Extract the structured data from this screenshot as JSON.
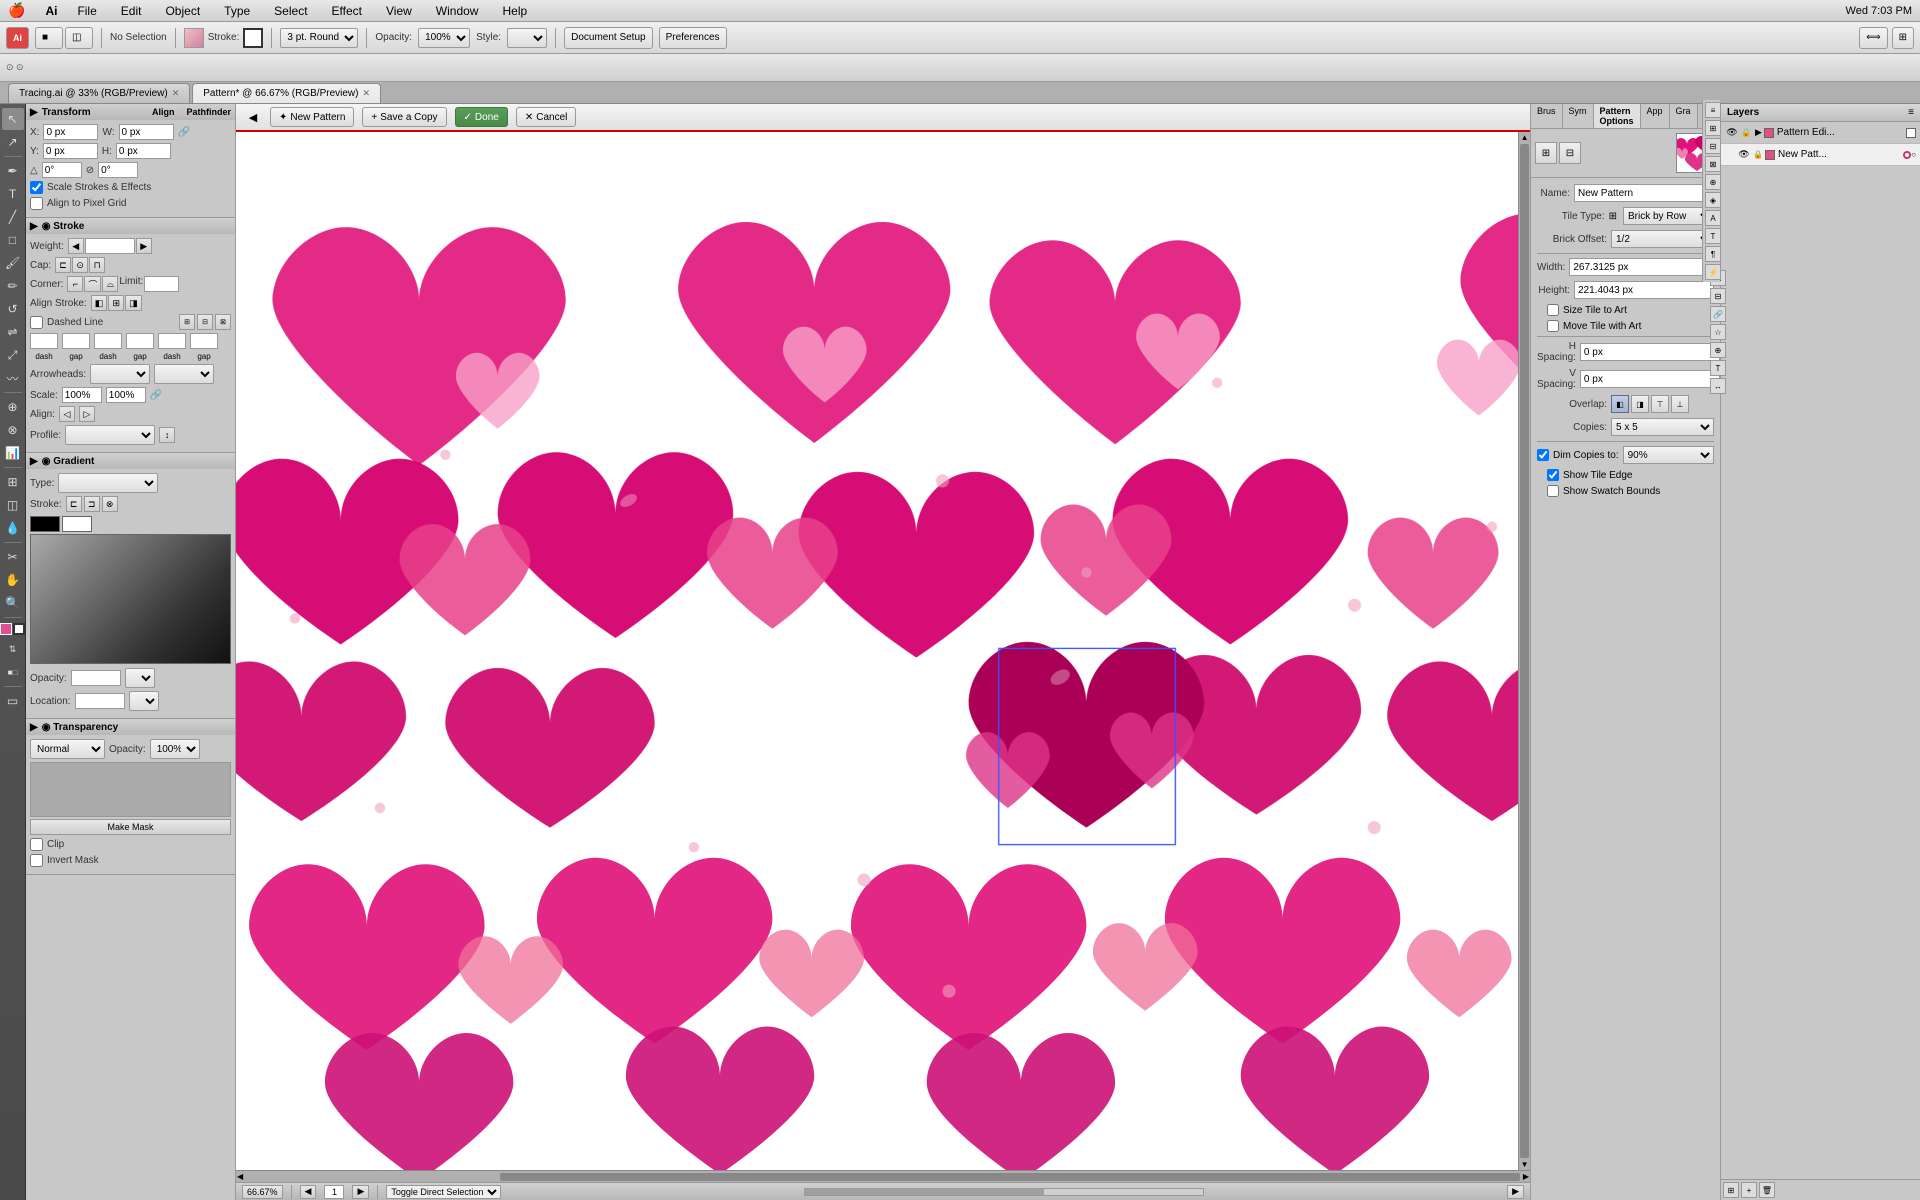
{
  "menubar": {
    "apple": "🍎",
    "app": "Illustrator",
    "items": [
      "File",
      "Edit",
      "Object",
      "Type",
      "Select",
      "Effect",
      "View",
      "Window",
      "Help"
    ],
    "right": "Wed 7:03 PM"
  },
  "toolbar": {
    "selection_label": "No Selection",
    "stroke_label": "Stroke:",
    "stroke_value": "",
    "weight_label": "3 pt. Round",
    "opacity_label": "Opacity:",
    "opacity_value": "100%",
    "style_label": "Style:",
    "btn_document_setup": "Document Setup",
    "btn_preferences": "Preferences"
  },
  "tabs": [
    {
      "id": "tab1",
      "label": "Tracing.ai @ 33% (RGB/Preview)",
      "active": false
    },
    {
      "id": "tab2",
      "label": "Pattern* @ 66.67% (RGB/Preview)",
      "active": true
    }
  ],
  "pattern_bar": {
    "new_pattern": "New Pattern",
    "save_copy": "Save a Copy",
    "done": "Done",
    "cancel": "Cancel"
  },
  "left_panel": {
    "transform": {
      "title": "Transform",
      "x_label": "X:",
      "x_value": "0 px",
      "y_label": "Y:",
      "y_value": "0 px",
      "w_label": "W:",
      "w_value": "0 px",
      "h_label": "H:",
      "h_value": "0 px",
      "scale_strokes": "Scale Strokes & Effects",
      "align_pixel": "Align to Pixel Grid"
    },
    "stroke": {
      "title": "Stroke",
      "weight_label": "Weight:",
      "cap_label": "Cap:",
      "corner_label": "Corner:",
      "limit_label": "Limit:",
      "align_label": "Align Stroke:",
      "dashed_label": "Dashed Line",
      "dash_label": "dash",
      "gap_label": "gap",
      "arrowheads_label": "Arrowheads:",
      "scale_label": "Scale:",
      "scale_val1": "100%",
      "scale_val2": "100%",
      "align_label2": "Align:"
    },
    "gradient": {
      "title": "Gradient",
      "type_label": "Type:",
      "stroke_label": "Stroke:",
      "opacity_label": "Opacity:",
      "location_label": "Location:"
    },
    "transparency": {
      "title": "Transparency",
      "mode": "Normal",
      "opacity": "100%",
      "make_mask": "Make Mask",
      "clip": "Clip",
      "invert_mask": "Invert Mask"
    }
  },
  "pattern_options": {
    "tabs": [
      "Brus",
      "Sym",
      "Pattern Options",
      "App",
      "Gra"
    ],
    "active_tab": "Pattern Options",
    "name_label": "Name:",
    "name_value": "New Pattern",
    "tile_type_label": "Tile Type:",
    "tile_type_value": "Brick by Row",
    "brick_offset_label": "Brick Offset:",
    "brick_offset_value": "1/2",
    "width_label": "Width:",
    "width_value": "267.3125 px",
    "height_label": "Height:",
    "height_value": "221.4043 px",
    "size_tile_art": "Size Tile to Art",
    "move_tile_art": "Move Tile with Art",
    "h_spacing_label": "H Spacing:",
    "h_spacing_value": "0 px",
    "v_spacing_label": "V Spacing:",
    "v_spacing_value": "0 px",
    "overlap_label": "Overlap:",
    "copies_label": "Copies:",
    "copies_value": "5 x 5",
    "dim_copies": "Dim Copies to:",
    "dim_value": "90%",
    "show_tile_edge": "Show Tile Edge",
    "show_swatch_bounds": "Show Swatch Bounds"
  },
  "layers": {
    "title": "Layers",
    "items": [
      {
        "label": "Pattern Edi...",
        "color": "#e05080",
        "visible": true,
        "locked": false,
        "expanded": true
      },
      {
        "label": "New Patt...",
        "color": "#e05080",
        "visible": true,
        "locked": false,
        "expanded": false,
        "indent": true
      }
    ]
  },
  "statusbar": {
    "zoom": "66.67%",
    "page": "1",
    "tool": "Toggle Direct Selection"
  },
  "icons": {
    "arrow": "▶",
    "triangle_down": "▼",
    "triangle_right": "▶",
    "close": "✕",
    "check": "✓",
    "link": "🔗",
    "eye": "👁",
    "lock": "🔒"
  }
}
